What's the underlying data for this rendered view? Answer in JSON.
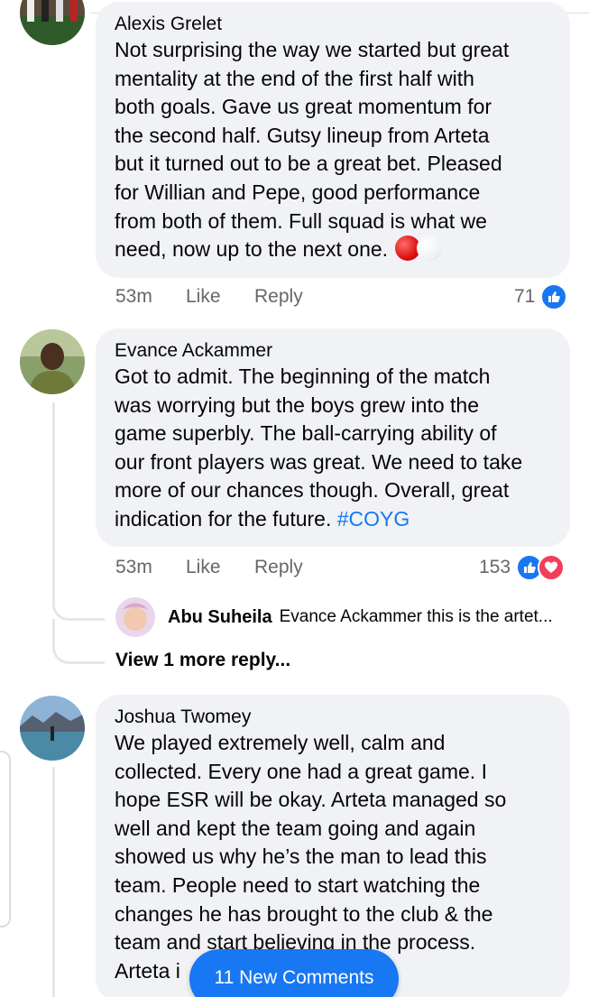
{
  "comments": [
    {
      "author": "Alexis Grelet",
      "lines": [
        "Not surprising the way we started but great",
        "mentality at the end of the first half with",
        "both goals. Gave us great momentum for",
        "the second half. Gutsy lineup from Arteta",
        "but it turned out to be a great bet. Pleased",
        "for Willian and Pepe, good performance",
        "from both of them. Full squad is what we",
        "need, now up to the next one."
      ],
      "emoji": [
        "red-circle",
        "white-circle"
      ],
      "time": "53m",
      "like_label": "Like",
      "reply_label": "Reply",
      "reaction_count": "71",
      "reactions": [
        "like"
      ]
    },
    {
      "author": "Evance Ackammer",
      "lines": [
        "Got to admit. The beginning of the match",
        "was worrying but the boys grew into the",
        "game superbly. The ball-carrying ability of",
        "our front players was great. We need to take",
        "more of our chances though. Overall, great",
        "indication for the future."
      ],
      "hashtag": "#COYG",
      "time": "53m",
      "like_label": "Like",
      "reply_label": "Reply",
      "reaction_count": "153",
      "reactions": [
        "like",
        "love"
      ],
      "reply": {
        "author": "Abu Suheila",
        "text": "Evance Ackammer this is the artet..."
      },
      "view_more": "View 1 more reply..."
    },
    {
      "author": "Joshua Twomey",
      "lines": [
        "We played extremely well, calm and",
        "collected. Every one had a great game. I",
        "hope ESR will be okay. Arteta managed so",
        "well and kept the team going and again",
        "showed us why he’s the man to lead this",
        "team. People need to start watching the",
        "changes he has brought to the club & the",
        "team and start believing in the process.",
        "Arteta i"
      ]
    }
  ],
  "new_comments_button": "11 New Comments",
  "colors": {
    "bubble": "#f0f2f5",
    "meta_text": "#65676b",
    "accent": "#1877f2",
    "love": "#f33e58"
  }
}
